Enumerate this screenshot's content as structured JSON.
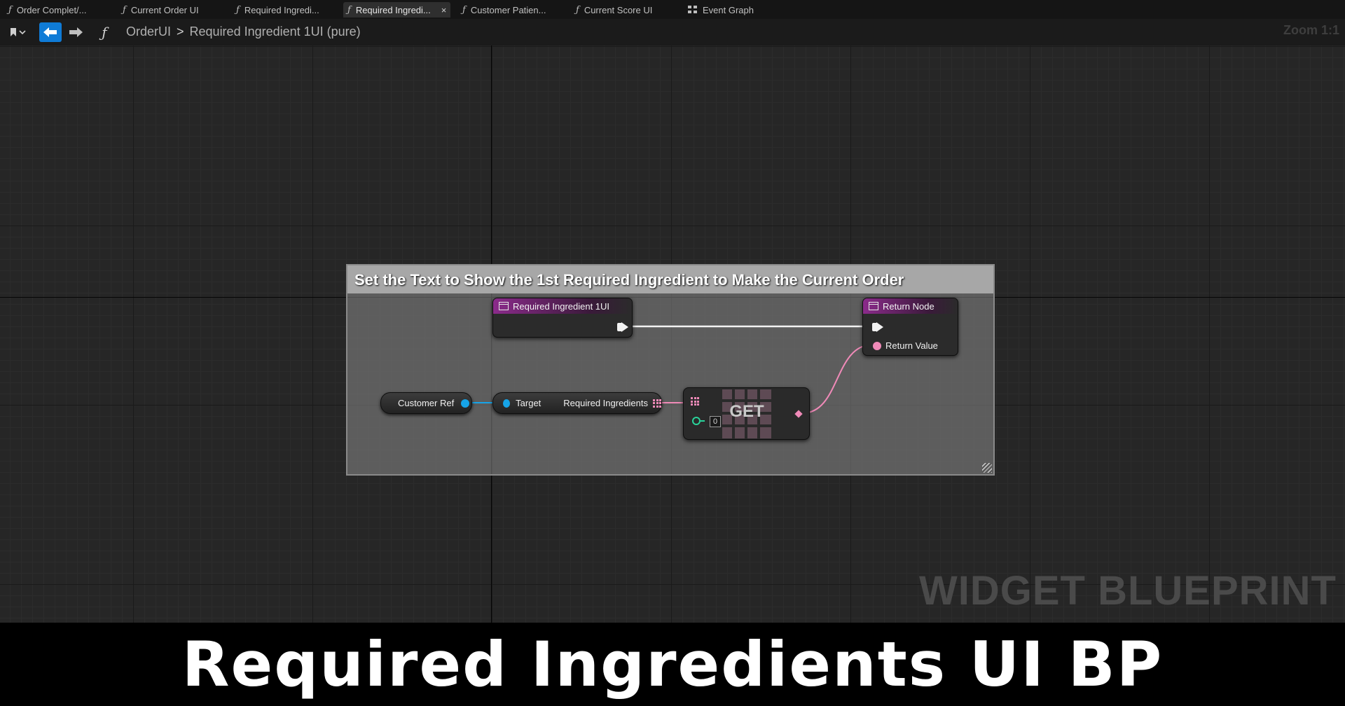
{
  "tabs": [
    {
      "label": "Order Complet/...",
      "type": "function"
    },
    {
      "label": "Current Order UI",
      "type": "function"
    },
    {
      "label": "Required Ingredi...",
      "type": "function"
    },
    {
      "label": "Required Ingredi...",
      "type": "function",
      "active": true,
      "close": "×"
    },
    {
      "label": "Customer Patien...",
      "type": "function"
    },
    {
      "label": "Current Score UI",
      "type": "function"
    },
    {
      "label": "Event Graph",
      "type": "graph"
    }
  ],
  "toolbar": {
    "back_icon": "arrow-left-icon",
    "forward_icon": "arrow-right-icon",
    "function_glyph": "ƒ",
    "breadcrumb_root": "OrderUI",
    "breadcrumb_separator": ">",
    "breadcrumb_current": "Required Ingredient 1UI (pure)",
    "zoom": "Zoom 1:1"
  },
  "graph": {
    "watermark": "WIDGET BLUEPRINT",
    "comment": {
      "title": "Set the Text to Show the 1st Required Ingredient to Make the Current Order",
      "color": "#a7a7a7"
    },
    "nodes": {
      "entry": {
        "title": "Required Ingredient 1UI"
      },
      "return": {
        "title": "Return Node",
        "pin_label": "Return Value"
      },
      "customer_ref": {
        "label": "Customer Ref"
      },
      "getter": {
        "target_label": "Target",
        "output_label": "Required Ingredients"
      },
      "get": {
        "label": "GET",
        "index": "0"
      }
    },
    "colors": {
      "object_pin": "#16a4e8",
      "text_pin": "#f08ab8",
      "int_pin": "#29d39a",
      "function_header": "#8b2b8b",
      "exec_wire": "#f2f2f2"
    }
  },
  "caption": "Required Ingredients UI BP"
}
